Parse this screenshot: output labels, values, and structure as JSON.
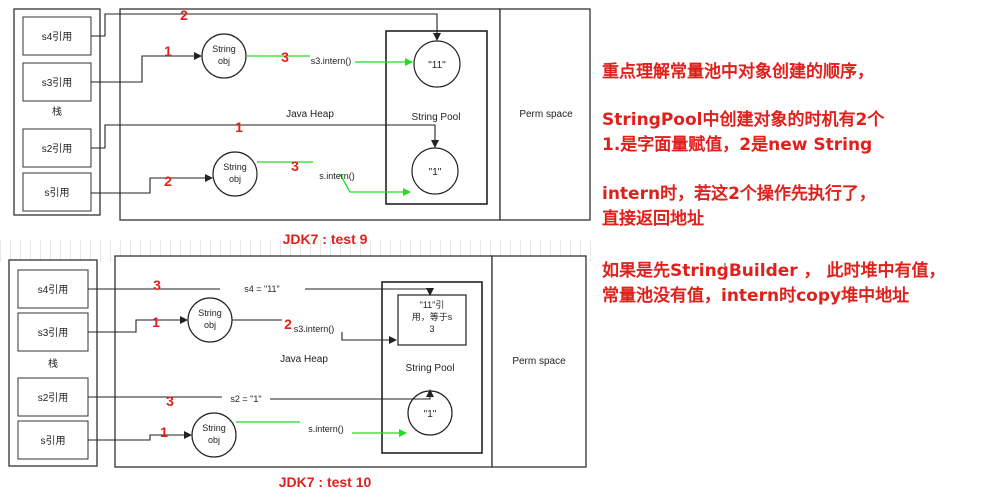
{
  "top": {
    "stack_labels": [
      "s4引用",
      "s3引用",
      "s2引用",
      "s引用"
    ],
    "stack_caption": "栈",
    "heap_label": "Java Heap",
    "pool_label": "String Pool",
    "perm_label": "Perm space",
    "obj1_label": [
      "String",
      "obj"
    ],
    "obj2_label": [
      "String",
      "obj"
    ],
    "pool1_label": "\"11\"",
    "pool2_label": "\"1\"",
    "call1": "s3.intern()",
    "call2": "s.intern()",
    "nums": [
      "2",
      "1",
      "3",
      "1",
      "2",
      "3"
    ],
    "caption": "JDK7 :  test 9"
  },
  "bottom": {
    "stack_labels": [
      "s4引用",
      "s3引用",
      "s2引用",
      "s引用"
    ],
    "stack_caption": "栈",
    "heap_label": "Java Heap",
    "pool_label": "String Pool",
    "perm_label": "Perm space",
    "obj1_label": [
      "String",
      "obj"
    ],
    "obj2_label": [
      "String",
      "obj"
    ],
    "pool_ref_label": [
      "\"11\"引",
      "用，等于s",
      "3"
    ],
    "pool2_label": "\"1\"",
    "assign1": "s4 = \"11\"",
    "call1": "s3.intern()",
    "assign2": "s2 = \"1\"",
    "call2": "s.intern()",
    "nums": [
      "3",
      "1",
      "2",
      "3",
      "1"
    ],
    "caption": "JDK7  :   test 10"
  },
  "notes": [
    "重点理解常量池中对象创建的顺序，",
    "StringPool中创建对象的时机有2个",
    "1.是字面量赋值，2是new String",
    "intern时，若这2个操作先执行了，",
    "直接返回地址",
    "如果是先StringBuilder ，  此时堆中有值，",
    "常量池没有值，intern时copy堆中地址"
  ],
  "colors": {
    "accent": "#e1201c",
    "green": "#22dd22",
    "line": "#333333"
  }
}
